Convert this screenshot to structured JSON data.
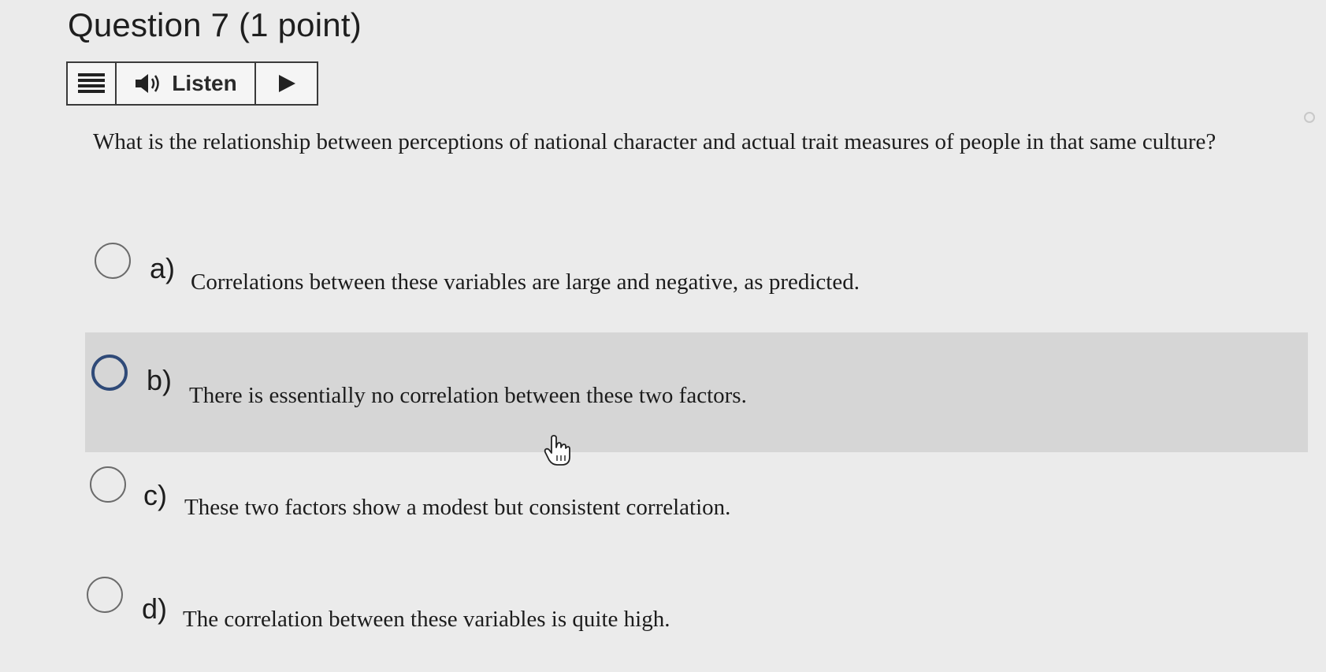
{
  "header": {
    "title": "Question 7 (1 point)"
  },
  "toolbar": {
    "listen_label": "Listen",
    "menu_icon": "menu-icon",
    "speaker_icon": "speaker-icon",
    "play_icon": "play-icon"
  },
  "question": {
    "text": "What is the relationship between perceptions of national character and actual trait measures of people in that same culture?"
  },
  "options": [
    {
      "letter": "a)",
      "text": "Correlations between these variables are large and negative, as predicted."
    },
    {
      "letter": "b)",
      "text": "There is essentially no correlation between these two factors."
    },
    {
      "letter": "c)",
      "text": "These two factors show a modest but consistent correlation."
    },
    {
      "letter": "d)",
      "text": "The correlation between these variables is quite high."
    }
  ],
  "colors": {
    "page_background": "#ebebeb",
    "hover_row": "#d6d6d6",
    "radio_focus": "#2f4a78"
  }
}
